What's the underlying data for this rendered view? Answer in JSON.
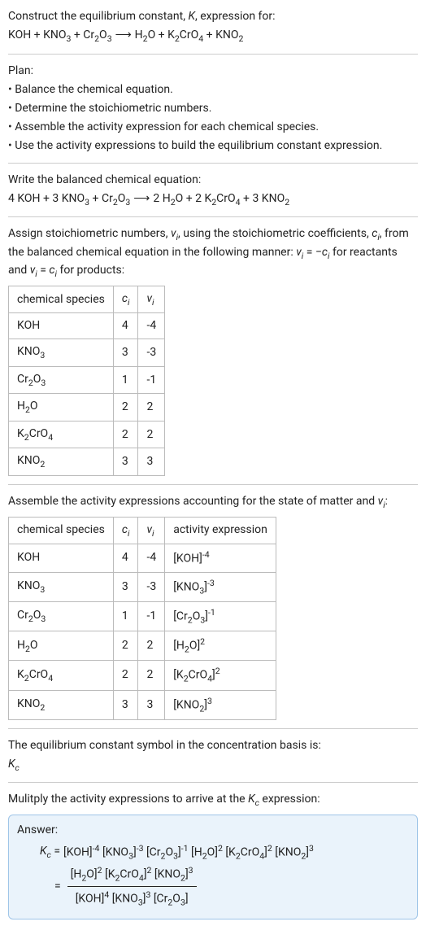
{
  "intro": {
    "line1_a": "Construct the equilibrium constant, ",
    "line1_b": ", expression for:"
  },
  "unbalanced": {
    "lhs": [
      {
        "base": "KOH"
      },
      {
        "base": "KNO",
        "sub": "3"
      },
      {
        "base": "Cr",
        "sub": "2",
        "base2": "O",
        "sub2": "3"
      }
    ],
    "rhs": [
      {
        "base": "H",
        "sub": "2",
        "base2": "O"
      },
      {
        "base": "K",
        "sub": "2",
        "base2": "CrO",
        "sub2": "4"
      },
      {
        "base": "KNO",
        "sub": "2"
      }
    ]
  },
  "plan": {
    "heading": "Plan:",
    "items": [
      "Balance the chemical equation.",
      "Determine the stoichiometric numbers.",
      "Assemble the activity expression for each chemical species.",
      "Use the activity expressions to build the equilibrium constant expression."
    ]
  },
  "balanced_heading": "Write the balanced chemical equation:",
  "balanced": {
    "lhs": [
      {
        "coef": "4",
        "base": "KOH"
      },
      {
        "coef": "3",
        "base": "KNO",
        "sub": "3"
      },
      {
        "coef": "",
        "base": "Cr",
        "sub": "2",
        "base2": "O",
        "sub2": "3"
      }
    ],
    "rhs": [
      {
        "coef": "2",
        "base": "H",
        "sub": "2",
        "base2": "O"
      },
      {
        "coef": "2",
        "base": "K",
        "sub": "2",
        "base2": "CrO",
        "sub2": "4"
      },
      {
        "coef": "3",
        "base": "KNO",
        "sub": "2"
      }
    ]
  },
  "assign": {
    "t1": "Assign stoichiometric numbers, ",
    "t2": ", using the stoichiometric coefficients, ",
    "t3": ", from the balanced chemical equation in the following manner: ",
    "t4": " for reactants and ",
    "t5": " for products:"
  },
  "table1": {
    "headers": {
      "species": "chemical species"
    },
    "rows": [
      {
        "sp": {
          "base": "KOH"
        },
        "c": "4",
        "v": "-4"
      },
      {
        "sp": {
          "base": "KNO",
          "sub": "3"
        },
        "c": "3",
        "v": "-3"
      },
      {
        "sp": {
          "base": "Cr",
          "sub": "2",
          "base2": "O",
          "sub2": "3"
        },
        "c": "1",
        "v": "-1"
      },
      {
        "sp": {
          "base": "H",
          "sub": "2",
          "base2": "O"
        },
        "c": "2",
        "v": "2"
      },
      {
        "sp": {
          "base": "K",
          "sub": "2",
          "base2": "CrO",
          "sub2": "4"
        },
        "c": "2",
        "v": "2"
      },
      {
        "sp": {
          "base": "KNO",
          "sub": "2"
        },
        "c": "3",
        "v": "3"
      }
    ]
  },
  "assemble_heading_a": "Assemble the activity expressions accounting for the state of matter and ",
  "assemble_heading_b": ":",
  "table2": {
    "headers": {
      "species": "chemical species",
      "activity": "activity expression"
    },
    "rows": [
      {
        "sp": {
          "base": "KOH"
        },
        "c": "4",
        "v": "-4",
        "exp": "-4"
      },
      {
        "sp": {
          "base": "KNO",
          "sub": "3"
        },
        "c": "3",
        "v": "-3",
        "exp": "-3"
      },
      {
        "sp": {
          "base": "Cr",
          "sub": "2",
          "base2": "O",
          "sub2": "3"
        },
        "c": "1",
        "v": "-1",
        "exp": "-1"
      },
      {
        "sp": {
          "base": "H",
          "sub": "2",
          "base2": "O"
        },
        "c": "2",
        "v": "2",
        "exp": "2"
      },
      {
        "sp": {
          "base": "K",
          "sub": "2",
          "base2": "CrO",
          "sub2": "4"
        },
        "c": "2",
        "v": "2",
        "exp": "2"
      },
      {
        "sp": {
          "base": "KNO",
          "sub": "2"
        },
        "c": "3",
        "v": "3",
        "exp": "3"
      }
    ]
  },
  "symbol_line": "The equilibrium constant symbol in the concentration basis is:",
  "multiply_a": "Mulitply the activity expressions to arrive at the ",
  "multiply_b": " expression:",
  "answer": {
    "label": "Answer:",
    "terms_line1": [
      {
        "base": "KOH",
        "exp": "-4"
      },
      {
        "base": "KNO",
        "sub": "3",
        "exp": "-3"
      },
      {
        "base": "Cr",
        "sub": "2",
        "base2": "O",
        "sub2": "3",
        "exp": "-1"
      },
      {
        "base": "H",
        "sub": "2",
        "base2": "O",
        "exp": "2"
      },
      {
        "base": "K",
        "sub": "2",
        "base2": "CrO",
        "sub2": "4",
        "exp": "2"
      },
      {
        "base": "KNO",
        "sub": "2",
        "exp": "3"
      }
    ],
    "num": [
      {
        "base": "H",
        "sub": "2",
        "base2": "O",
        "exp": "2"
      },
      {
        "base": "K",
        "sub": "2",
        "base2": "CrO",
        "sub2": "4",
        "exp": "2"
      },
      {
        "base": "KNO",
        "sub": "2",
        "exp": "3"
      }
    ],
    "den": [
      {
        "base": "KOH",
        "exp": "4"
      },
      {
        "base": "KNO",
        "sub": "3",
        "exp": "3"
      },
      {
        "base": "Cr",
        "sub": "2",
        "base2": "O",
        "sub2": "3",
        "exp": ""
      }
    ]
  }
}
